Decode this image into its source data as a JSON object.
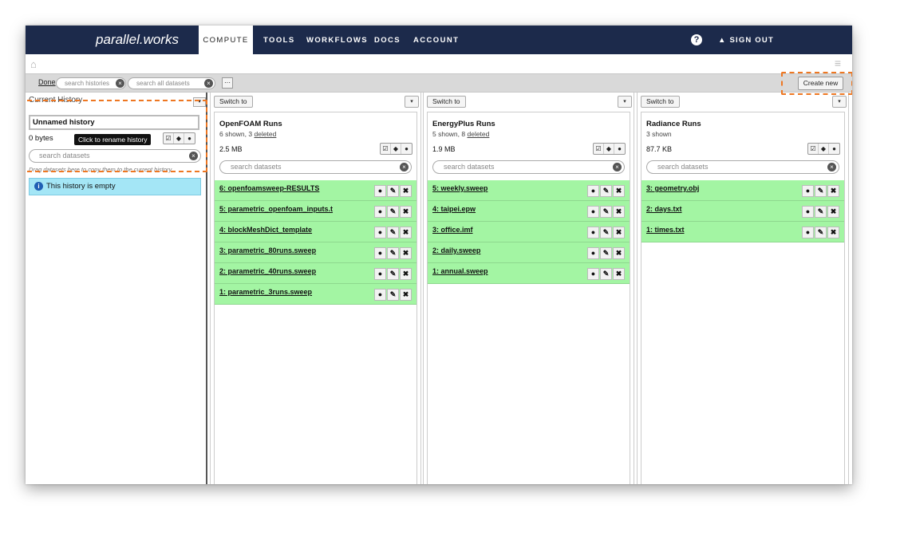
{
  "nav": {
    "brand": "parallel.works",
    "items": [
      "COMPUTE",
      "TOOLS",
      "WORKFLOWS",
      "DOCS",
      "ACCOUNT"
    ],
    "help": "?",
    "signout": "▲ SIGN OUT"
  },
  "toolbar": {
    "done": "Done",
    "search_histories_placeholder": "search histories",
    "search_all_placeholder": "search all datasets",
    "more": "···",
    "create_new": "Create new"
  },
  "current_history": {
    "title": "Current History",
    "name_value": "Unnamed history",
    "size": "0 bytes",
    "tooltip": "Click to rename history",
    "search_placeholder": "search datasets",
    "drag_hint": "Drag datasets here to copy them to the current history",
    "empty_message": "This history is empty"
  },
  "histories": [
    {
      "switch_label": "Switch to",
      "name": "OpenFOAM Runs",
      "shown": "6 shown, 3 ",
      "deleted": "deleted",
      "size": "2.5 MB",
      "search_placeholder": "search datasets",
      "datasets": [
        "6: openfoamsweep-RESULTS",
        "5: parametric_openfoam_inputs.t",
        "4: blockMeshDict_template",
        "3: parametric_80runs.sweep",
        "2: parametric_40runs.sweep",
        "1: parametric_3runs.sweep"
      ]
    },
    {
      "switch_label": "Switch to",
      "name": "EnergyPlus Runs",
      "shown": "5 shown, 8 ",
      "deleted": "deleted",
      "size": "1.9 MB",
      "search_placeholder": "search datasets",
      "datasets": [
        "5: weekly.sweep",
        "4: taipei.epw",
        "3: office.imf",
        "2: daily.sweep",
        "1: annual.sweep"
      ]
    },
    {
      "switch_label": "Switch to",
      "name": "Radiance Runs",
      "shown": "3 shown",
      "deleted": "",
      "size": "87.7 KB",
      "search_placeholder": "search datasets",
      "datasets": [
        "3: geometry.obj",
        "2: days.txt",
        "1: times.txt"
      ]
    }
  ],
  "icons": {
    "view": "eye-icon",
    "edit": "pencil-icon",
    "delete": "close-icon",
    "highlight_color": "#ee7722",
    "nav_bg": "#1c2a4b",
    "dataset_bg": "#a3f5a3"
  }
}
